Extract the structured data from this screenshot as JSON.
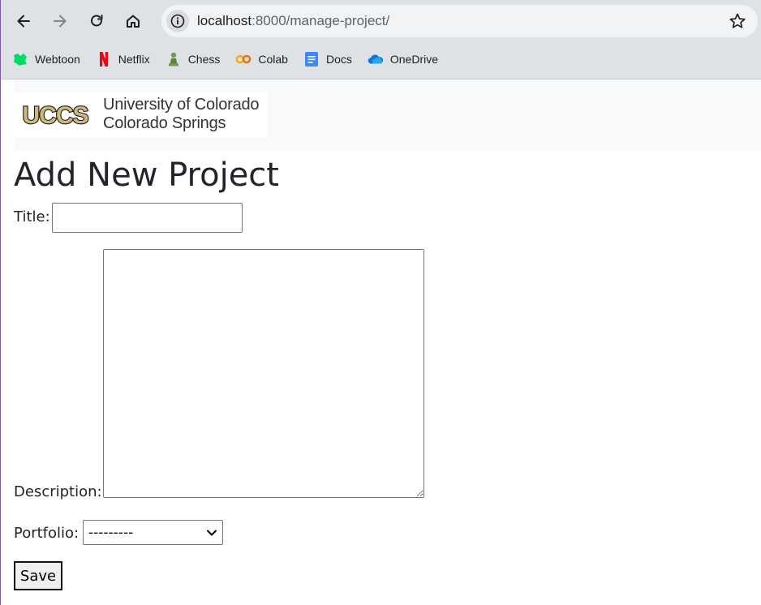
{
  "browser": {
    "url_host": "localhost",
    "url_rest": ":8000/manage-project/",
    "bookmarks": [
      {
        "label": "Webtoon",
        "icon": "webtoon-icon",
        "color": "#00dc64"
      },
      {
        "label": "Netflix",
        "icon": "netflix-icon",
        "color": "#e50914"
      },
      {
        "label": "Chess",
        "icon": "chess-pawn-icon",
        "color": "#769656"
      },
      {
        "label": "Colab",
        "icon": "colab-icon",
        "color": "#f9ab00"
      },
      {
        "label": "Docs",
        "icon": "docs-icon",
        "color": "#4285f4"
      },
      {
        "label": "OneDrive",
        "icon": "onedrive-icon",
        "color": "#0f78d4"
      }
    ]
  },
  "header": {
    "logo_mark": "UCCS",
    "logo_line1": "University of Colorado",
    "logo_line2": "Colorado Springs"
  },
  "form": {
    "page_title": "Add New Project",
    "title_label": "Title:",
    "title_value": "",
    "description_label": "Description:",
    "description_value": "",
    "portfolio_label": "Portfolio:",
    "portfolio_selected": "---------",
    "save_label": "Save"
  }
}
